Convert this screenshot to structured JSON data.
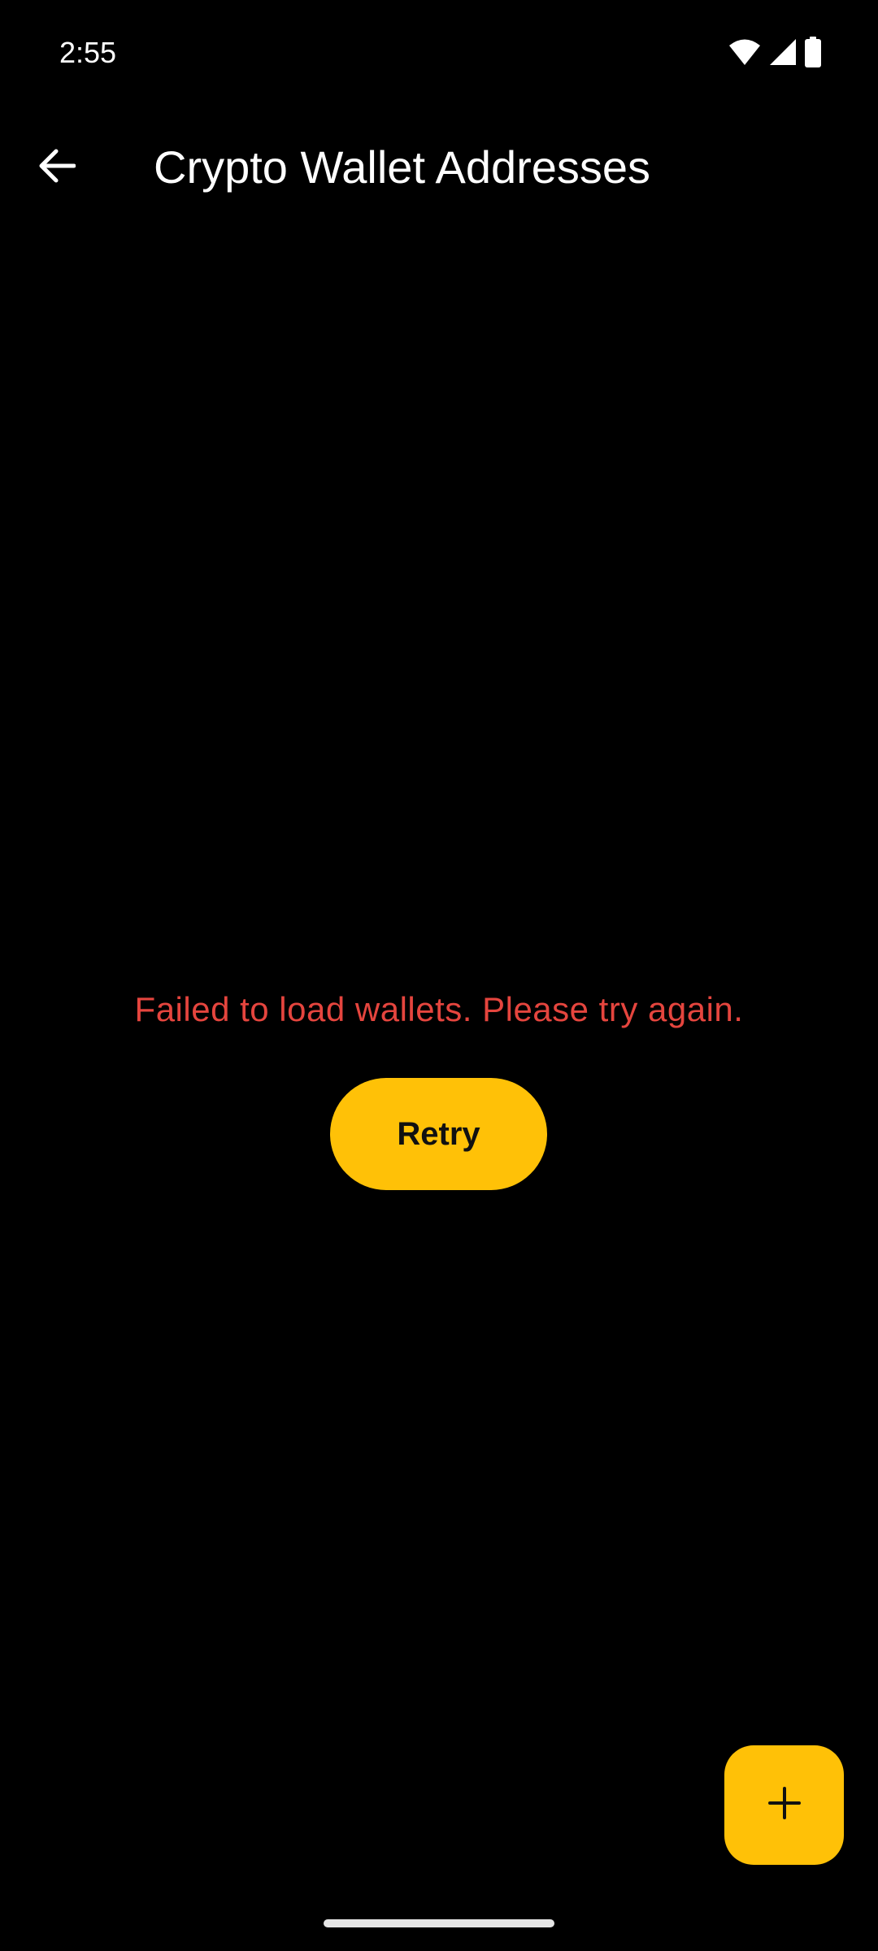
{
  "status_bar": {
    "time": "2:55",
    "icons": [
      "wifi-icon",
      "cellular-signal-icon",
      "battery-icon"
    ]
  },
  "app_bar": {
    "back_icon": "arrow-back-icon",
    "title": "Crypto Wallet Addresses"
  },
  "content": {
    "error_message": "Failed to load wallets. Please try again.",
    "retry_label": "Retry"
  },
  "fab": {
    "icon": "plus-icon"
  },
  "colors": {
    "background": "#000000",
    "accent": "#FFC107",
    "error": "#E5453E",
    "text_primary": "#FFFFFF"
  }
}
